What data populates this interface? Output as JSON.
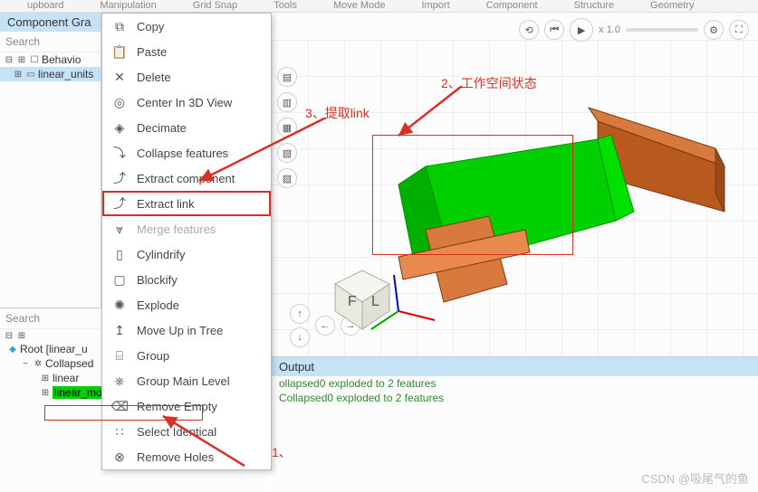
{
  "topbar": {
    "items": [
      "upboard",
      "Manipulation",
      "Grid Snap",
      "Tools",
      "Move Mode",
      "Import",
      "Component",
      "Structure",
      "Geometry"
    ]
  },
  "left": {
    "title": "Component Gra",
    "search": "Search",
    "row1": "Behavio",
    "row2": "linear_units"
  },
  "left_lower": {
    "search": "Search",
    "root": "Root [linear_u",
    "c0": "Collapsed",
    "c1": "linear",
    "c2": "linear_motion"
  },
  "ctx": {
    "copy": "Copy",
    "paste": "Paste",
    "delete": "Delete",
    "center": "Center In 3D View",
    "decimate": "Decimate",
    "collapse": "Collapse features",
    "extractc": "Extract component",
    "extractl": "Extract link",
    "merge": "Merge features",
    "cyl": "Cylindrify",
    "block": "Blockify",
    "explode": "Explode",
    "moveup": "Move Up in Tree",
    "group": "Group",
    "gmain": "Group Main Level",
    "rempty": "Remove Empty",
    "selid": "Select Identical",
    "rholes": "Remove Holes"
  },
  "viewport": {
    "speed": "x 1.0"
  },
  "output": {
    "title": "Output",
    "l1": "ollapsed0 exploded to 2 features",
    "l2": "Collapsed0 exploded to 2 features"
  },
  "annot": {
    "a1": "1、",
    "a2": "2、工作空间状态",
    "a3": "3、提取link"
  },
  "watermark": "CSDN @吸尾气的鱼"
}
